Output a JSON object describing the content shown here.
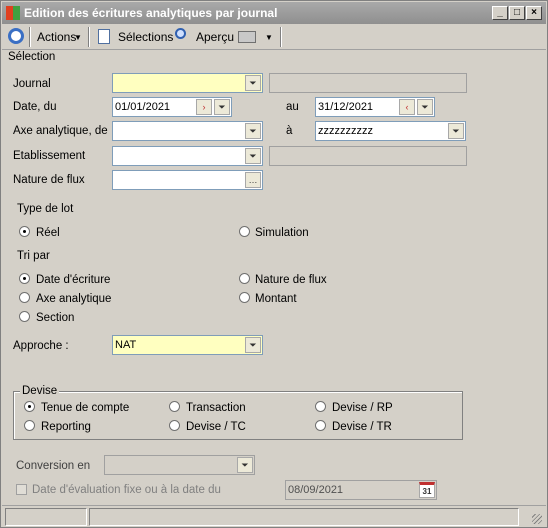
{
  "window": {
    "title": "Edition des écritures analytiques par journal"
  },
  "toolbar": {
    "actions": "Actions",
    "selections": "Sélections",
    "apercu": "Aperçu"
  },
  "section": "Sélection",
  "fields": {
    "journal": {
      "label": "Journal",
      "value": ""
    },
    "date": {
      "label": "Date, du",
      "from": "01/01/2021",
      "to_label": "au",
      "to": "31/12/2021"
    },
    "axe": {
      "label": "Axe analytique, de",
      "from": "",
      "to_label": "à",
      "to": "zzzzzzzzzz"
    },
    "etab": {
      "label": "Etablissement",
      "value": ""
    },
    "nature": {
      "label": "Nature de flux",
      "value": ""
    }
  },
  "type_lot": {
    "label": "Type de lot",
    "reel": "Réel",
    "simulation": "Simulation"
  },
  "tri": {
    "label": "Tri par",
    "date": "Date d'écriture",
    "nature": "Nature de flux",
    "axe": "Axe analytique",
    "montant": "Montant",
    "section": "Section"
  },
  "approche": {
    "label": "Approche :",
    "value": "NAT"
  },
  "devise": {
    "label": "Devise",
    "tenue": "Tenue de compte",
    "transaction": "Transaction",
    "rp": "Devise / RP",
    "reporting": "Reporting",
    "tc": "Devise / TC",
    "tr": "Devise / TR"
  },
  "conversion": {
    "label": "Conversion en",
    "value": ""
  },
  "date_eval": {
    "label": "Date d'évaluation fixe ou à la date du",
    "value": "08/09/2021",
    "cal": "31"
  }
}
